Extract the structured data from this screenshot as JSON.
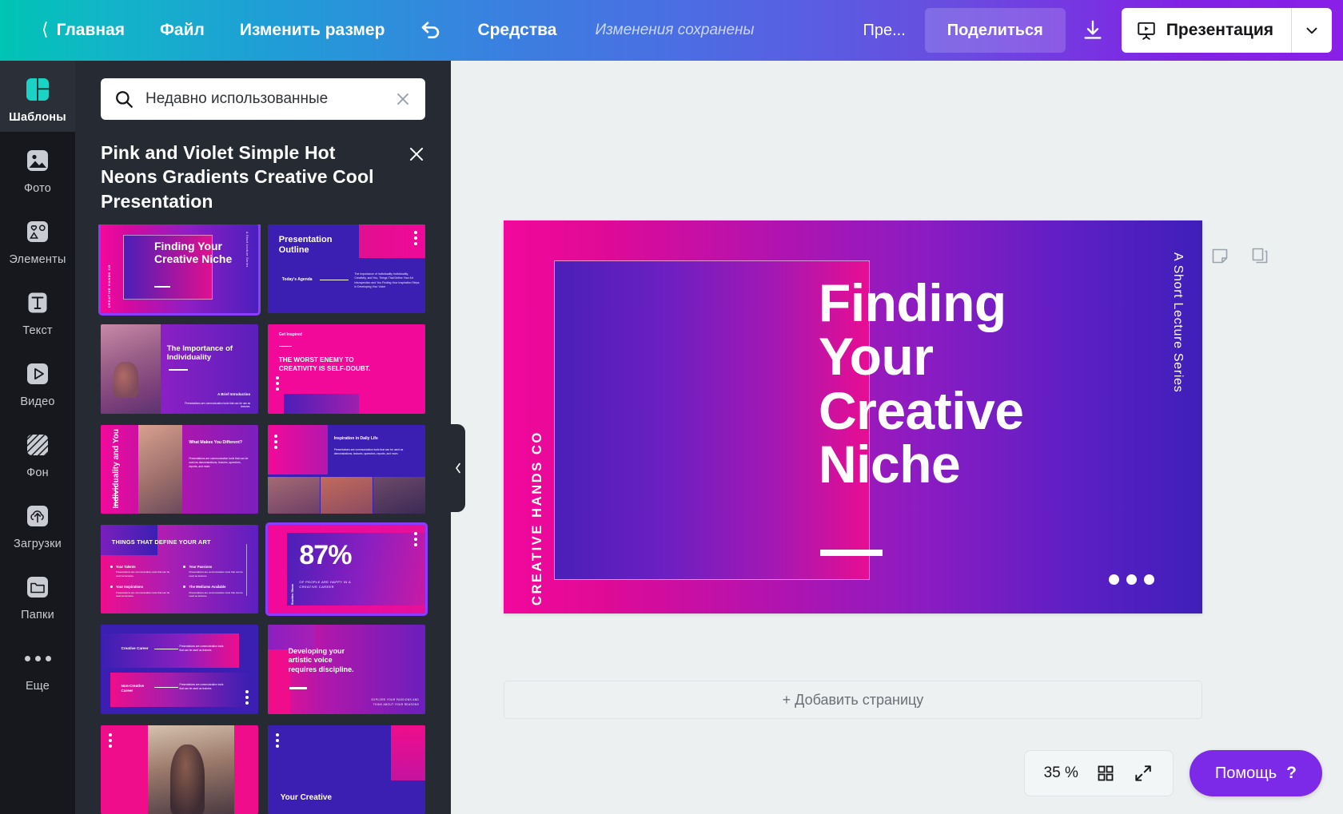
{
  "topbar": {
    "home": "Главная",
    "file": "Файл",
    "resize": "Изменить размер",
    "undo_icon": "undo-icon",
    "tools": "Средства",
    "saved_status": "Изменения сохранены",
    "preview": "Пре...",
    "share": "Поделиться",
    "download_icon": "download-icon",
    "present": "Презентация",
    "present_icon": "presentation-screen-icon",
    "caret_icon": "chevron-down-icon"
  },
  "rail": {
    "items": [
      {
        "label": "Шаблоны",
        "icon": "templates-icon",
        "active": true
      },
      {
        "label": "Фото",
        "icon": "photo-icon",
        "active": false
      },
      {
        "label": "Элементы",
        "icon": "elements-icon",
        "active": false
      },
      {
        "label": "Текст",
        "icon": "text-icon",
        "active": false
      },
      {
        "label": "Видео",
        "icon": "video-icon",
        "active": false
      },
      {
        "label": "Фон",
        "icon": "background-icon",
        "active": false
      },
      {
        "label": "Загрузки",
        "icon": "upload-icon",
        "active": false
      },
      {
        "label": "Папки",
        "icon": "folder-icon",
        "active": false
      },
      {
        "label": "Еще",
        "icon": "more-dots-icon",
        "active": false
      }
    ]
  },
  "panel": {
    "search_value": "Недавно использованные",
    "search_icon": "search-icon",
    "search_clear_icon": "close-icon",
    "title": "Pink and Violet Simple Hot Neons Gradients Creative Cool Presentation",
    "close_icon": "close-icon",
    "thumbnails": [
      {
        "id": 1,
        "title": "Finding Your Creative Niche",
        "side_label": "CREATIVE HANDS CO",
        "right_label": "A Short Lecture Series",
        "selected": true
      },
      {
        "id": 2,
        "title": "Presentation Outline",
        "label": "Today's Agenda",
        "body": "The Importance of Individuality Individuality, Creativity, and You, Things That Define Your Art Introspection and You Finding Your Inspiration Steps in Developing Your Voice",
        "selected": false
      },
      {
        "id": 3,
        "title": "The Importance of Individuality",
        "label": "A Brief Introduction",
        "body": "Presentations are communication tools that can be use as lectures.",
        "selected": false
      },
      {
        "id": 4,
        "label": "Get Inspired",
        "title": "THE WORST ENEMY TO CREATIVITY IS SELF-DOUBT.",
        "selected": false
      },
      {
        "id": 5,
        "side_title": "Individuality and You",
        "title": "What Makes You Different?",
        "body": "Presentations are communication tools that can be used as demonstrations, lectures, speeches, reports, and more.",
        "selected": false
      },
      {
        "id": 6,
        "title": "Inspiration in Daily Life",
        "body": "Presentations are communication tools that can be used as demonstrations, lectures, speeches, reports, and more.",
        "selected": false
      },
      {
        "id": 7,
        "title": "THINGS THAT DEFINE YOUR ART",
        "bullets": [
          "Your Talents",
          "Your Passions",
          "Your Inspirations",
          "The Mediums Available"
        ],
        "bullet_body": "Presentations are communication tools that can be used as lectures.",
        "selected": false
      },
      {
        "id": 8,
        "stat": "87%",
        "stat_caption": "OF PEOPLE ARE HAPPY IN A CREATIVE CAREER",
        "side_label": "Studies Show",
        "selected": true
      },
      {
        "id": 9,
        "rows": [
          "Creative Career",
          "Non-Creative Career"
        ],
        "body": "Presentations are communication tools that can be used as lectures.",
        "selected": false
      },
      {
        "id": 10,
        "title": "Developing your artistic voice requires discipline.",
        "side_body": "EXPLORE YOUR PASSIONS AND THINK ABOUT YOUR REASONS",
        "selected": false
      },
      {
        "id": 11,
        "photo": true,
        "selected": false
      },
      {
        "id": 12,
        "title": "Your Creative",
        "selected": false
      }
    ]
  },
  "canvas": {
    "collapse_icon": "chevron-left-icon",
    "notes_icon": "sticky-note-icon",
    "duplicate_icon": "copy-icon",
    "slide": {
      "title_lines": [
        "Finding",
        "Your",
        "Creative",
        "Niche"
      ],
      "left_vertical_label": "CREATIVE HANDS CO",
      "right_vertical_label": "A Short Lecture Series",
      "dots_count": 3
    },
    "add_page": "+ Добавить страницу"
  },
  "bottom": {
    "zoom": "35 %",
    "grid_icon": "grid-view-icon",
    "fullscreen_icon": "expand-icon",
    "help": "Помощь",
    "help_mark": "?"
  },
  "colors": {
    "accent_purple": "#7d2ae8",
    "panel_bg": "#252a33",
    "rail_bg": "#16181d",
    "brand_teal": "#19d3c5",
    "pink": "#ef0d8c",
    "violet": "#4a1fb8"
  }
}
